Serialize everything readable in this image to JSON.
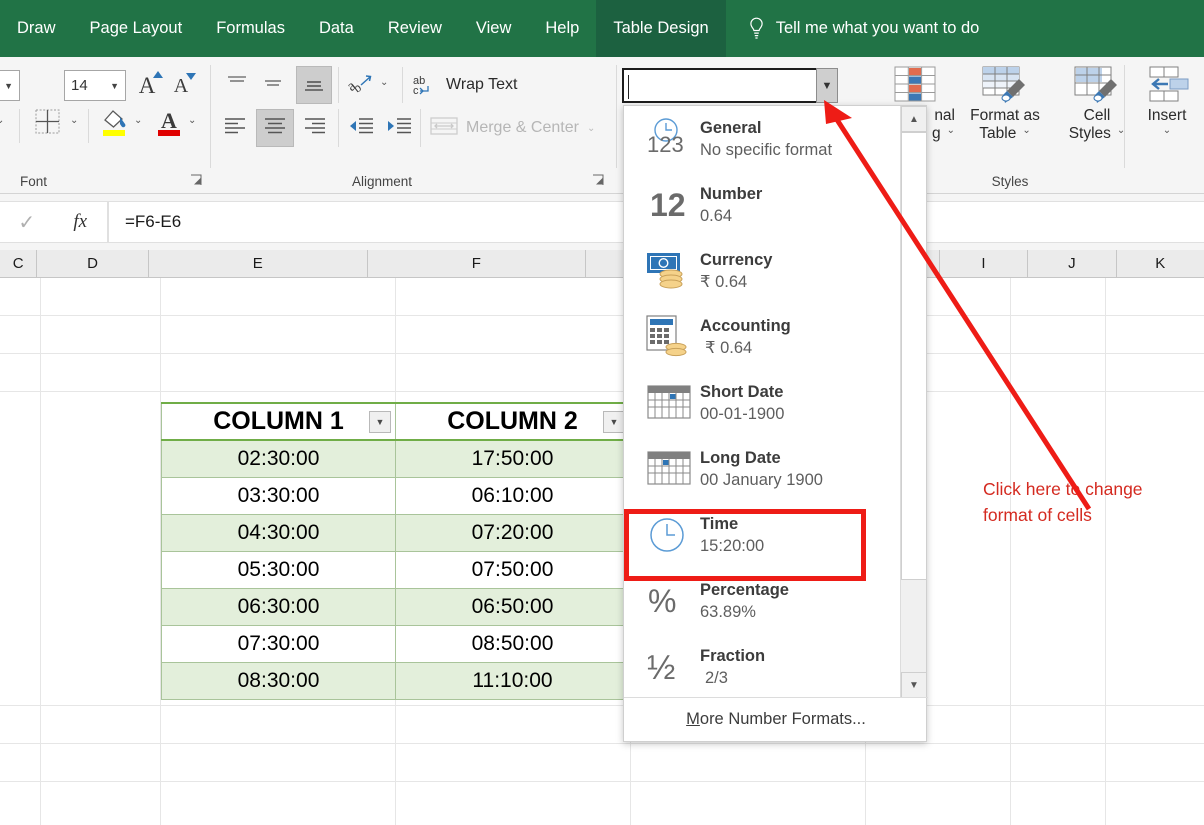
{
  "accent_green": "#217346",
  "annotation_red": "#d42a20",
  "highlight_red": "#ee1c16",
  "table_green": "#e3efdb",
  "ribbon_tabs": [
    {
      "label": "Draw",
      "active": false
    },
    {
      "label": "Page Layout",
      "active": false
    },
    {
      "label": "Formulas",
      "active": false
    },
    {
      "label": "Data",
      "active": false
    },
    {
      "label": "Review",
      "active": false
    },
    {
      "label": "View",
      "active": false
    },
    {
      "label": "Help",
      "active": false
    },
    {
      "label": "Table Design",
      "active": true
    }
  ],
  "tell_me": {
    "label": "Tell me what you want to do",
    "icon": "lightbulb-icon"
  },
  "ribbon": {
    "font_group": {
      "label": "Font",
      "font_name_value": "",
      "font_size_value": "14",
      "grow_font_icon": "increase-font-size-icon",
      "shrink_font_icon": "decrease-font-size-icon",
      "borders_icon": "borders-icon",
      "fill_color_icon": "fill-color-icon",
      "font_color_icon": "font-color-icon",
      "dialog_launcher_icon": "dialog-launcher-icon"
    },
    "alignment_group": {
      "label": "Alignment",
      "top_align_icon": "align-top-icon",
      "middle_align_icon": "align-middle-icon",
      "bottom_align_icon": "align-bottom-icon",
      "orientation_icon": "text-orientation-icon",
      "wrap_text_label": "Wrap Text",
      "wrap_text_icon": "wrap-text-icon",
      "align_left_icon": "align-left-icon",
      "align_center_icon": "align-center-icon",
      "align_right_icon": "align-right-icon",
      "decrease_indent_icon": "decrease-indent-icon",
      "increase_indent_icon": "increase-indent-icon",
      "merge_center_label": "Merge & Center",
      "merge_center_icon": "merge-cells-icon",
      "dialog_launcher_icon": "dialog-launcher-icon"
    },
    "number_group": {
      "number_format_value": "",
      "number_format_placeholder": "",
      "dropdown_icon": "chevron-down-icon"
    },
    "styles_group": {
      "label": "Styles",
      "conditional_formatting_label_partial": "nal",
      "conditional_formatting_label_partial2": "g",
      "conditional_formatting_icon": "conditional-formatting-icon",
      "format_as_table_label_line1": "Format as",
      "format_as_table_label_line2": "Table",
      "format_as_table_icon": "format-as-table-icon",
      "cell_styles_label_line1": "Cell",
      "cell_styles_label_line2": "Styles",
      "cell_styles_icon": "cell-styles-icon"
    },
    "cells_group": {
      "insert_label": "Insert",
      "insert_icon": "insert-cells-icon"
    }
  },
  "formula_bar": {
    "accept_icon": "checkmark-icon",
    "function_icon": "fx-icon",
    "value": "=F6-E6"
  },
  "column_headers": [
    "C",
    "D",
    "E",
    "F",
    "I",
    "J",
    "K"
  ],
  "spreadsheet_table": {
    "headers": [
      "COLUMN 1",
      "COLUMN 2"
    ],
    "filter_icon": "filter-dropdown-icon",
    "rows": [
      [
        "02:30:00",
        "17:50:00"
      ],
      [
        "03:30:00",
        "06:10:00"
      ],
      [
        "04:30:00",
        "07:20:00"
      ],
      [
        "05:30:00",
        "07:50:00"
      ],
      [
        "06:30:00",
        "06:50:00"
      ],
      [
        "07:30:00",
        "08:50:00"
      ],
      [
        "08:30:00",
        "11:10:00"
      ]
    ]
  },
  "number_format_dropdown": {
    "items": [
      {
        "name": "General",
        "sample": "No specific format",
        "icon": "general-123-icon",
        "highlighted": false,
        "indent": false
      },
      {
        "name": "Number",
        "sample": "0.64",
        "icon": "number-12-icon",
        "highlighted": false,
        "indent": false
      },
      {
        "name": "Currency",
        "sample": "₹ 0.64",
        "icon": "currency-banknote-icon",
        "highlighted": false,
        "indent": false
      },
      {
        "name": "Accounting",
        "sample": "₹ 0.64",
        "icon": "accounting-calculator-icon",
        "highlighted": false,
        "indent": true
      },
      {
        "name": "Short Date",
        "sample": "00-01-1900",
        "icon": "short-date-calendar-icon",
        "highlighted": false,
        "indent": false
      },
      {
        "name": "Long Date",
        "sample": "00 January 1900",
        "icon": "long-date-calendar-icon",
        "highlighted": false,
        "indent": false
      },
      {
        "name": "Time",
        "sample": "15:20:00",
        "icon": "clock-icon",
        "highlighted": true,
        "indent": false
      },
      {
        "name": "Percentage",
        "sample": "63.89%",
        "icon": "percent-icon",
        "highlighted": false,
        "indent": false
      },
      {
        "name": "Fraction",
        "sample": "2/3",
        "icon": "fraction-half-icon",
        "highlighted": false,
        "indent": true
      }
    ],
    "footer_label_underlined": "M",
    "footer_label_rest": "ore Number Formats...",
    "scroll_up_icon": "scroll-up-arrow-icon",
    "scroll_down_icon": "scroll-down-arrow-icon"
  },
  "annotation": {
    "line1": "Click here to change",
    "line2": "format of cells",
    "arrow_icon": "arrow-pointer-icon"
  }
}
